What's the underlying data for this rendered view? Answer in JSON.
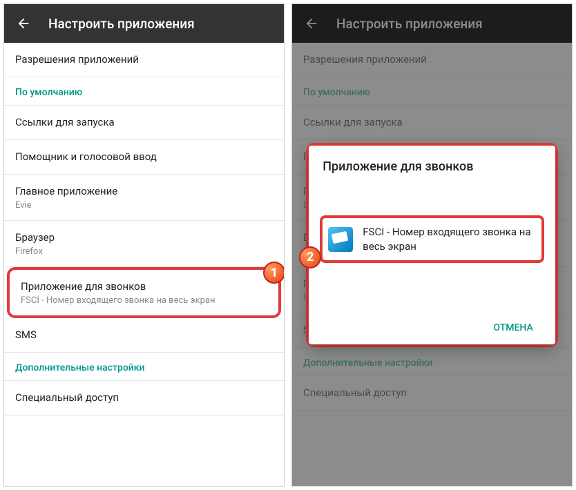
{
  "header": {
    "title": "Настроить приложения"
  },
  "items": {
    "permissions": "Разрешения приложений",
    "default_section": "По умолчанию",
    "links": "Ссылки для запуска",
    "assistant": "Помощник и голосовой ввод",
    "home_app": {
      "primary": "Главное приложение",
      "secondary": "Evie"
    },
    "browser": {
      "primary": "Браузер",
      "secondary": "Firefox"
    },
    "phone_app": {
      "primary": "Приложение для звонков",
      "secondary": "FSCI - Номер входящего звонка на весь экран"
    },
    "sms": "SMS",
    "extra_section": "Дополнительные настройки",
    "special": "Специальный доступ"
  },
  "dialog": {
    "title": "Приложение для звонков",
    "option": "FSCI - Номер входящего звонка на весь экран",
    "cancel": "ОТМЕНА"
  },
  "badges": {
    "b1": "1",
    "b2": "2"
  }
}
